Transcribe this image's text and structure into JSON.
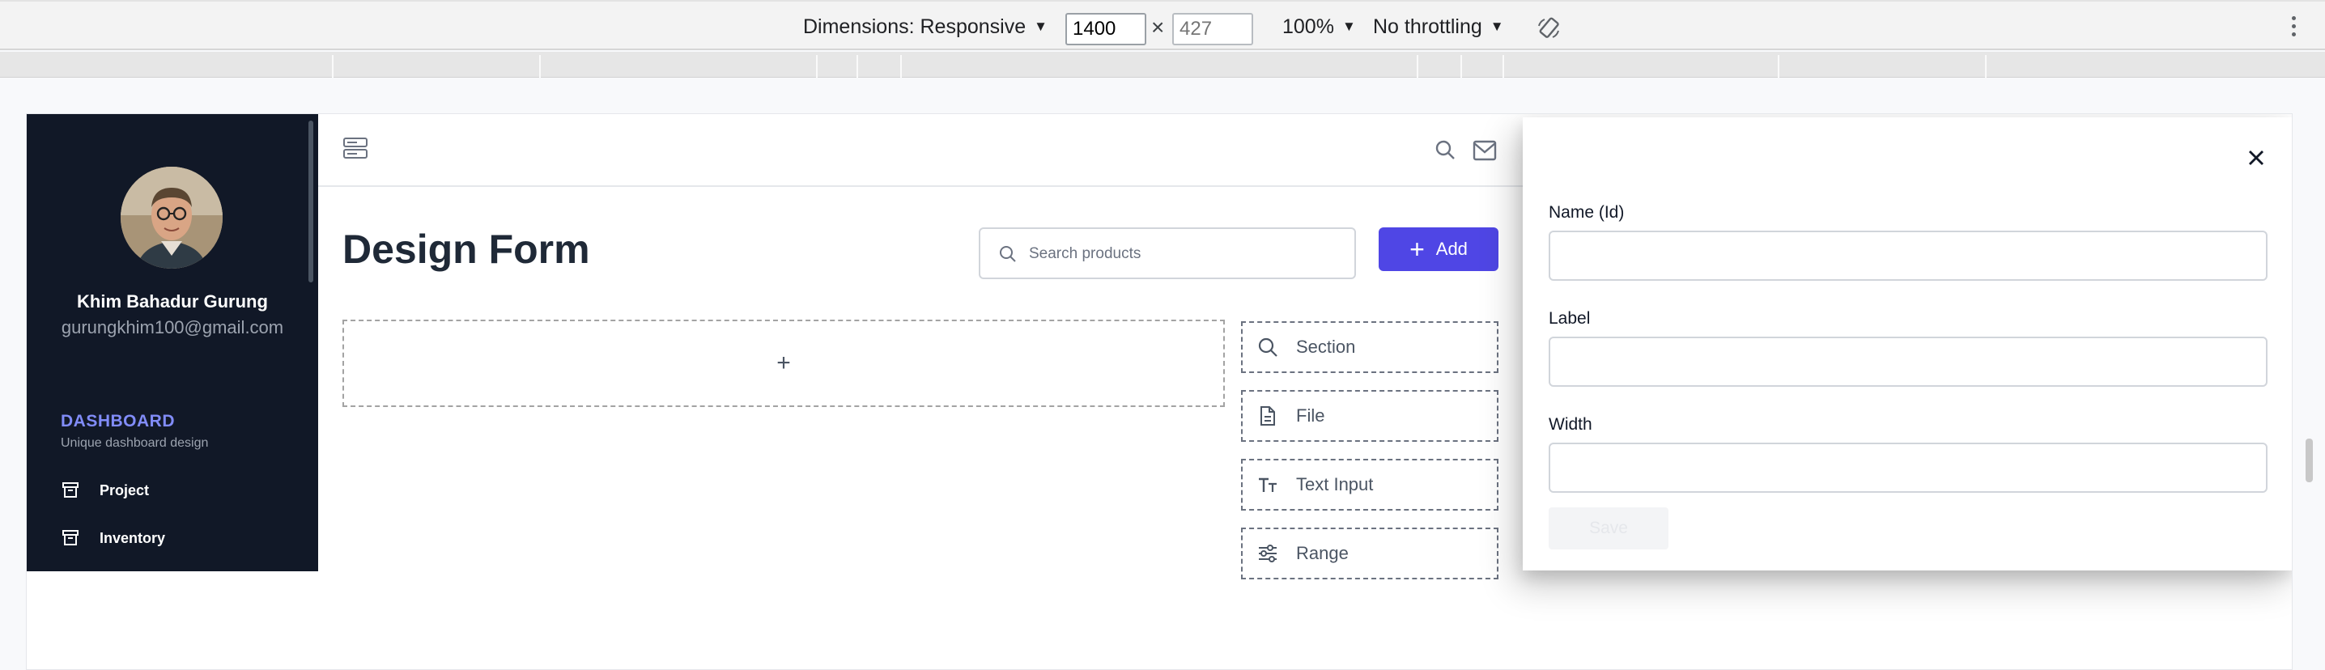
{
  "devtools": {
    "dimensions_label": "Dimensions: Responsive",
    "width_value": "1400",
    "height_placeholder": "427",
    "times_symbol": "×",
    "zoom_label": "100%",
    "throttle_label": "No throttling",
    "dropdown_glyph": "▼"
  },
  "sidebar": {
    "user_name": "Khim Bahadur Gurung",
    "user_email": "gurungkhim100@gmail.com",
    "section_title": "DASHBOARD",
    "section_subtitle": "Unique dashboard design",
    "items": [
      {
        "label": "Project",
        "icon": "archive-icon"
      },
      {
        "label": "Inventory",
        "icon": "archive-icon"
      }
    ]
  },
  "main": {
    "page_title": "Design Form",
    "search_placeholder": "Search products",
    "add_button_label": "Add",
    "add_glyph": "+",
    "drop_zone_glyph": "+",
    "tools": [
      {
        "label": "Section",
        "icon": "search-icon"
      },
      {
        "label": "File",
        "icon": "file-icon"
      },
      {
        "label": "Text Input",
        "icon": "text-type-icon"
      },
      {
        "label": "Range",
        "icon": "sliders-icon"
      }
    ]
  },
  "panel": {
    "fields": [
      {
        "label": "Name (Id)",
        "value": ""
      },
      {
        "label": "Label",
        "value": ""
      },
      {
        "label": "Width",
        "value": ""
      }
    ],
    "save_label": "Save"
  },
  "colors": {
    "sidebar_bg": "#111827",
    "accent": "#4f46e5",
    "accent_light": "#818cf8",
    "title": "#1f2937"
  }
}
